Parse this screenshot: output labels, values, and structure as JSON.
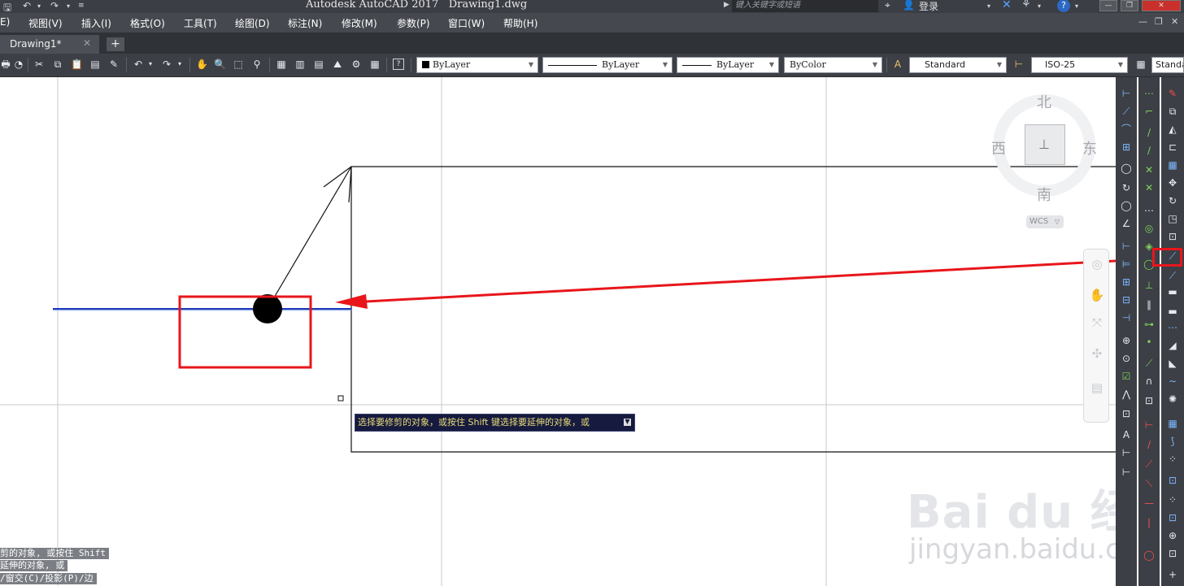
{
  "window": {
    "app_title": "Autodesk AutoCAD 2017",
    "file_name": "Drawing1.dwg",
    "search_placeholder": "键入关键字或短语",
    "login_label": "登录",
    "help_label": "?"
  },
  "menu": {
    "items": [
      "E)",
      "视图(V)",
      "插入(I)",
      "格式(O)",
      "工具(T)",
      "绘图(D)",
      "标注(N)",
      "修改(M)",
      "参数(P)",
      "窗口(W)",
      "帮助(H)"
    ]
  },
  "tabs": {
    "active": "Drawing1*",
    "add_label": "+"
  },
  "toolbar": {
    "color_combo": "ByLayer",
    "linetype_combo": "ByLayer",
    "lineweight_combo": "ByLayer",
    "plotstyle_combo": "ByColor",
    "textstyle_combo": "Standard",
    "dimstyle_combo": "ISO-25",
    "tablestyle_combo": "Standa"
  },
  "viewcube": {
    "north": "北",
    "south": "南",
    "east": "东",
    "west": "西",
    "wcs_label": "WCS"
  },
  "command_tooltip": {
    "text": "选择要修剪的对象，或按住 Shift 键选择要延伸的对象，或"
  },
  "command_history": {
    "lines": [
      "剪的对象, 或按住 Shift",
      "延伸的对象, 或",
      "/窗交(C)/投影(P)/边"
    ]
  },
  "watermark": {
    "main": "Bai du 经验",
    "sub": "jingyan.baidu.com"
  },
  "colors": {
    "app_dark": "#3c3f45",
    "highlight_red": "#e8161b",
    "selected_line_blue": "#1a37b8",
    "tooltip_bg": "#161a3e",
    "tooltip_text": "#e8dc7a"
  }
}
